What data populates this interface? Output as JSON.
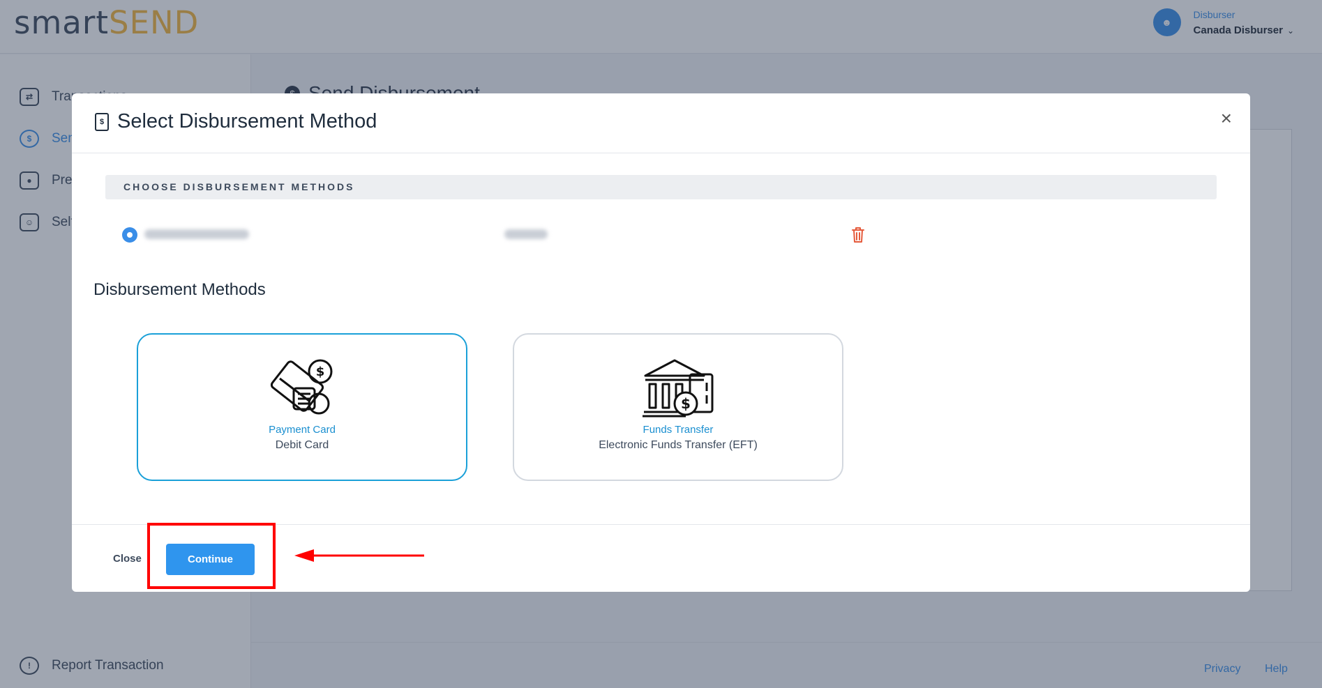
{
  "brand": {
    "part1": "smart",
    "part2": "SEND"
  },
  "user": {
    "role": "Disburser",
    "name": "Canada Disburser"
  },
  "sidebar": {
    "items": [
      {
        "label": "Transactions"
      },
      {
        "label": "Sen"
      },
      {
        "label": "Pre"
      },
      {
        "label": "Self"
      }
    ],
    "report": "Report Transaction"
  },
  "content": {
    "title": "Send Disbursement"
  },
  "footer": {
    "privacy": "Privacy",
    "help": "Help"
  },
  "modal": {
    "title": "Select Disbursement Method",
    "close_symbol": "×",
    "choose_heading": "CHOOSE DISBURSEMENT METHODS",
    "methods_heading": "Disbursement Methods",
    "cards": [
      {
        "title": "Payment Card",
        "subtitle": "Debit Card",
        "selected": true
      },
      {
        "title": "Funds Transfer",
        "subtitle": "Electronic Funds Transfer (EFT)",
        "selected": false
      }
    ],
    "close_label": "Close",
    "continue_label": "Continue"
  },
  "colors": {
    "accent": "#2f95ee",
    "brand_highlight": "#f4b63c",
    "annotation": "#ff0000",
    "danger": "#e55a3b"
  },
  "icons": [
    "user-icon",
    "transactions-icon",
    "dollar-icon",
    "card-icon",
    "profile-icon",
    "alert-icon",
    "document-icon",
    "trash-icon",
    "payment-card-icon",
    "bank-icon"
  ]
}
